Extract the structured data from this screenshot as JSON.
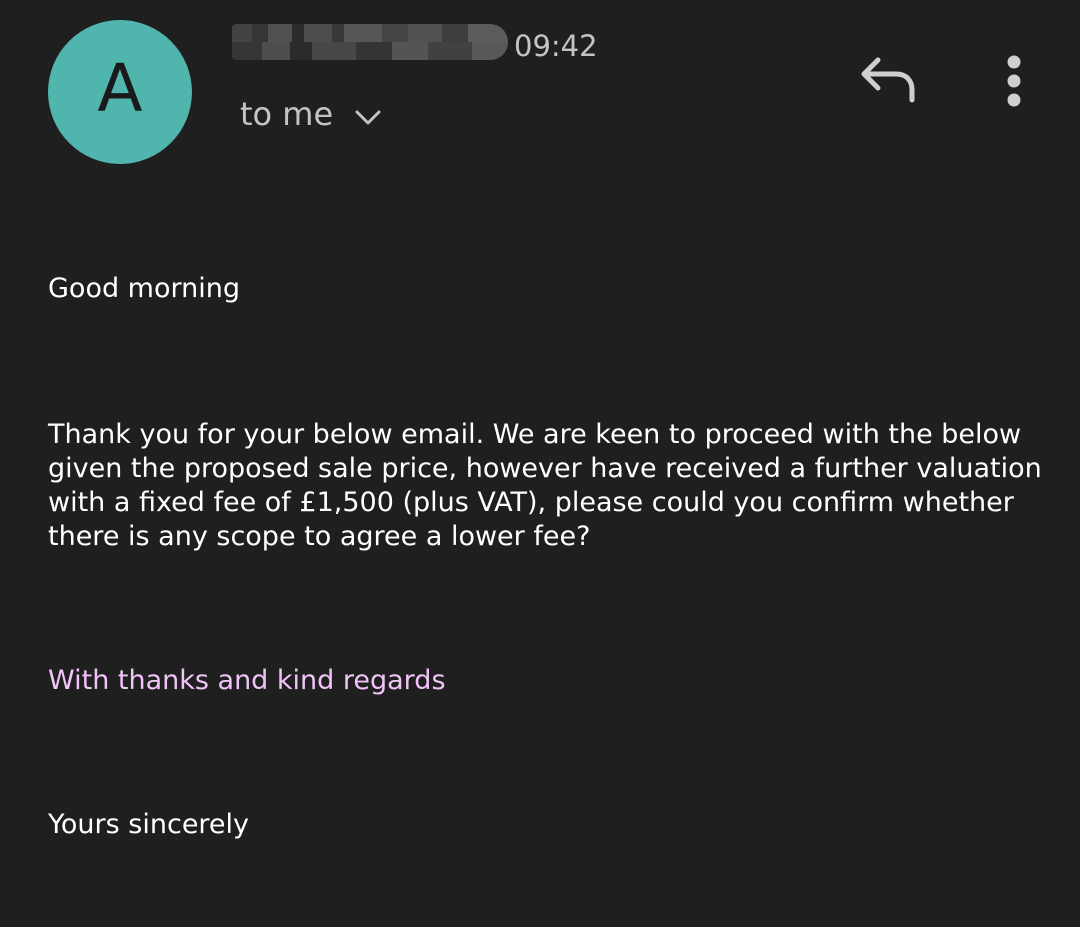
{
  "header": {
    "avatar_letter": "A",
    "avatar_color": "#4fb5ad",
    "time": "09:42",
    "recipient_label": "to me",
    "icons": {
      "reply": "reply-icon",
      "more": "more-vert-icon",
      "expand": "chevron-down-icon"
    }
  },
  "body": {
    "greeting": "Good morning",
    "paragraph": "Thank you for your below email. We are keen to proceed with the below given the proposed sale price, however have received a further valuation with a fixed fee of £1,500 (plus VAT), please could you confirm whether there is any scope to agree a lower fee?",
    "signoff": "With thanks and kind regards",
    "closing": "Yours sincerely"
  },
  "colors": {
    "background": "#1f1f1f",
    "text": "#ffffff",
    "secondary_text": "#c4c4c4",
    "signoff_text": "#f0c4f7"
  }
}
